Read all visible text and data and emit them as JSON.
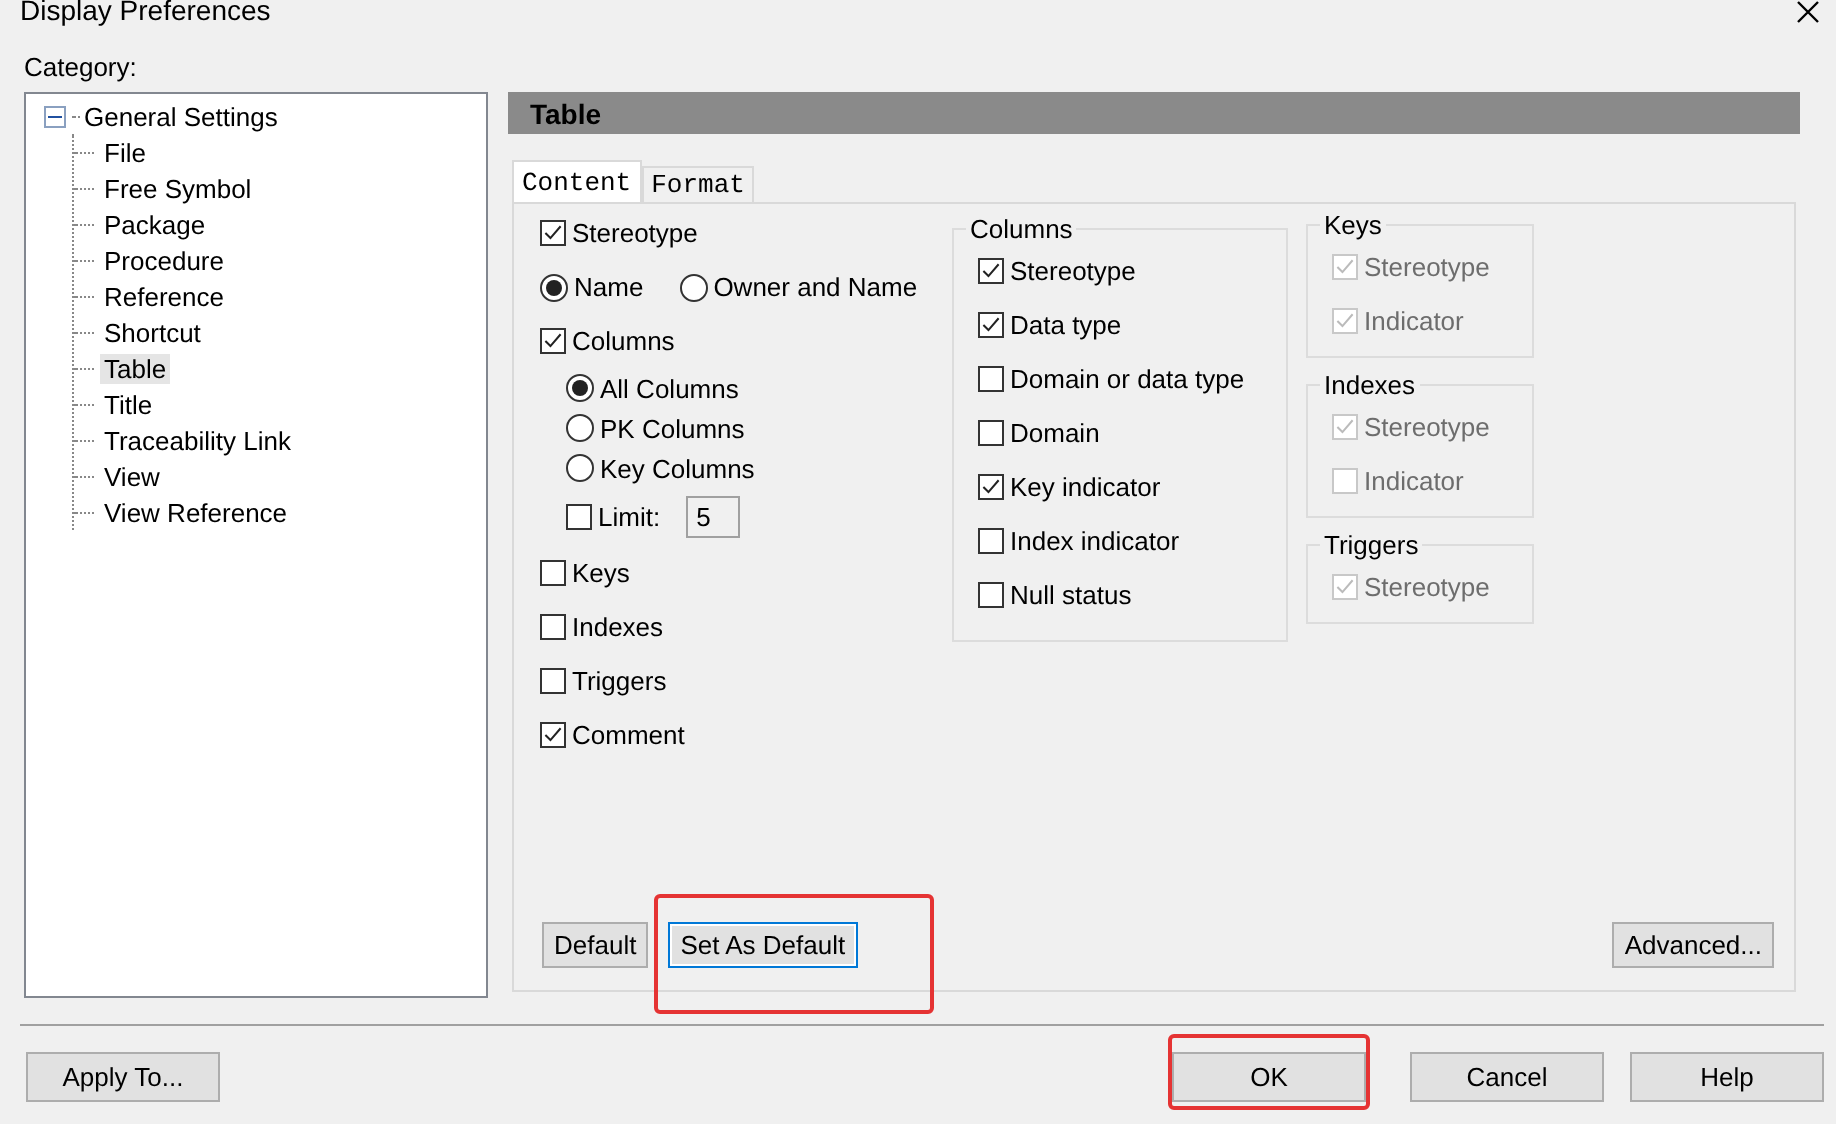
{
  "window": {
    "title": "Display Preferences"
  },
  "category_label": "Category:",
  "tree": {
    "label": "General Settings",
    "expanded": true,
    "children": [
      {
        "label": "File",
        "selected": false
      },
      {
        "label": "Free Symbol",
        "selected": false
      },
      {
        "label": "Package",
        "selected": false
      },
      {
        "label": "Procedure",
        "selected": false
      },
      {
        "label": "Reference",
        "selected": false
      },
      {
        "label": "Shortcut",
        "selected": false
      },
      {
        "label": "Table",
        "selected": true
      },
      {
        "label": "Title",
        "selected": false
      },
      {
        "label": "Traceability Link",
        "selected": false
      },
      {
        "label": "View",
        "selected": false
      },
      {
        "label": "View Reference",
        "selected": false
      }
    ]
  },
  "panel_title": "Table",
  "tabs": [
    {
      "label": "Content",
      "selected": true
    },
    {
      "label": "Format",
      "selected": false
    }
  ],
  "options": [
    {
      "kind": "checkbox",
      "label": "Stereotype",
      "checked": true
    },
    {
      "kind": "radio_row",
      "choices": [
        {
          "label": "Name",
          "selected": true
        },
        {
          "label": "Owner and Name",
          "selected": false
        }
      ]
    },
    {
      "kind": "checkbox",
      "label": "Columns",
      "checked": true
    },
    {
      "kind": "radio_group",
      "choices": [
        {
          "label": "All Columns",
          "selected": true
        },
        {
          "label": "PK Columns",
          "selected": false
        },
        {
          "label": "Key Columns",
          "selected": false
        }
      ]
    },
    {
      "kind": "limit",
      "label": "Limit:",
      "checked": false,
      "value": "5"
    },
    {
      "kind": "checkbox",
      "label": "Keys",
      "checked": false
    },
    {
      "kind": "checkbox",
      "label": "Indexes",
      "checked": false
    },
    {
      "kind": "checkbox",
      "label": "Triggers",
      "checked": false
    },
    {
      "kind": "checkbox",
      "label": "Comment",
      "checked": true
    }
  ],
  "groups": [
    {
      "title": "Columns",
      "items": [
        {
          "label": "Stereotype",
          "checked": true,
          "disabled": false
        },
        {
          "label": "Data type",
          "checked": true,
          "disabled": false
        },
        {
          "label": "Domain or data type",
          "checked": false,
          "disabled": false
        },
        {
          "label": "Domain",
          "checked": false,
          "disabled": false
        },
        {
          "label": "Key indicator",
          "checked": true,
          "disabled": false
        },
        {
          "label": "Index indicator",
          "checked": false,
          "disabled": false
        },
        {
          "label": "Null status",
          "checked": false,
          "disabled": false
        }
      ]
    },
    {
      "title": "Keys",
      "items": [
        {
          "label": "Stereotype",
          "checked": true,
          "disabled": true
        },
        {
          "label": "Indicator",
          "checked": true,
          "disabled": true
        }
      ]
    },
    {
      "title": "Indexes",
      "items": [
        {
          "label": "Stereotype",
          "checked": true,
          "disabled": true
        },
        {
          "label": "Indicator",
          "checked": false,
          "disabled": true
        }
      ]
    },
    {
      "title": "Triggers",
      "items": [
        {
          "label": "Stereotype",
          "checked": true,
          "disabled": true
        }
      ]
    }
  ],
  "tab_buttons": [
    {
      "label": "Default",
      "focused": false,
      "highlighted": false
    },
    {
      "label": "Set As Default",
      "focused": true,
      "highlighted": true
    }
  ],
  "advanced_button": "Advanced...",
  "footer_buttons": [
    {
      "label": "Apply To...",
      "highlighted": false
    },
    {
      "label": "OK",
      "highlighted": true
    },
    {
      "label": "Cancel",
      "highlighted": false
    },
    {
      "label": "Help",
      "highlighted": false
    }
  ]
}
